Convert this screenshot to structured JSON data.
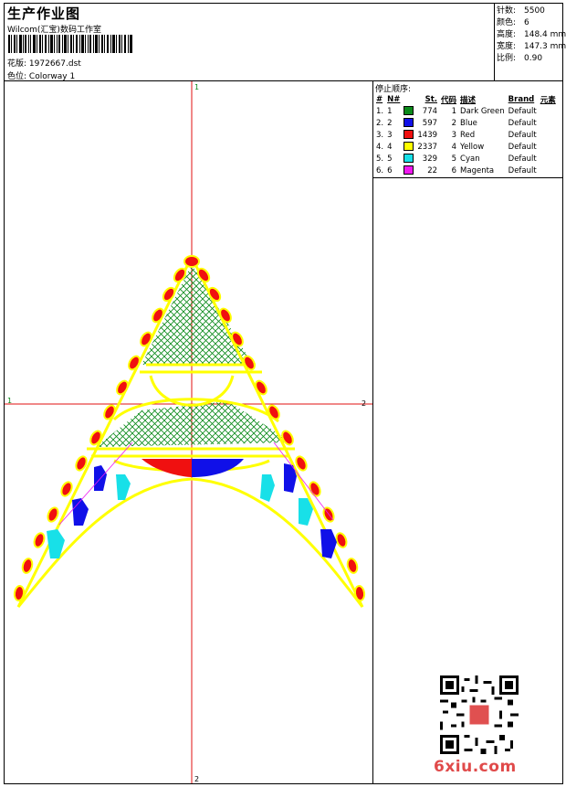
{
  "header": {
    "title": "生产作业图",
    "company": "Wilcom(汇宝)数码工作室",
    "design_label": "花版:",
    "design_value": "1972667.dst",
    "colorway_label": "色位:",
    "colorway_value": "Colorway 1"
  },
  "stats": [
    {
      "label": "针数:",
      "value": "5500"
    },
    {
      "label": "颜色:",
      "value": "6"
    },
    {
      "label": "高度:",
      "value": "148.4 mm"
    },
    {
      "label": "宽度:",
      "value": "147.3 mm"
    },
    {
      "label": "比例:",
      "value": "0.90"
    }
  ],
  "stop_sequence": {
    "title": "停止顺序:",
    "columns": [
      "#",
      "N#",
      "St.",
      "代码",
      "描述",
      "Brand",
      "元素"
    ],
    "rows": [
      {
        "idx": "1.",
        "n": "1",
        "color": "#0a8a1a",
        "st": "774",
        "code": "1",
        "desc": "Dark Green",
        "brand": "Default"
      },
      {
        "idx": "2.",
        "n": "2",
        "color": "#1010e8",
        "st": "597",
        "code": "2",
        "desc": "Blue",
        "brand": "Default"
      },
      {
        "idx": "3.",
        "n": "3",
        "color": "#f01010",
        "st": "1439",
        "code": "3",
        "desc": "Red",
        "brand": "Default"
      },
      {
        "idx": "4.",
        "n": "4",
        "color": "#ffff00",
        "st": "2337",
        "code": "4",
        "desc": "Yellow",
        "brand": "Default"
      },
      {
        "idx": "5.",
        "n": "5",
        "color": "#18e0e8",
        "st": "329",
        "code": "5",
        "desc": "Cyan",
        "brand": "Default"
      },
      {
        "idx": "6.",
        "n": "6",
        "color": "#f018f0",
        "st": "22",
        "code": "6",
        "desc": "Magenta",
        "brand": "Default"
      }
    ]
  },
  "axis_labels": {
    "top": "1",
    "left": "1",
    "right": "2",
    "bottom": "2"
  },
  "watermark": "6xiu.com"
}
